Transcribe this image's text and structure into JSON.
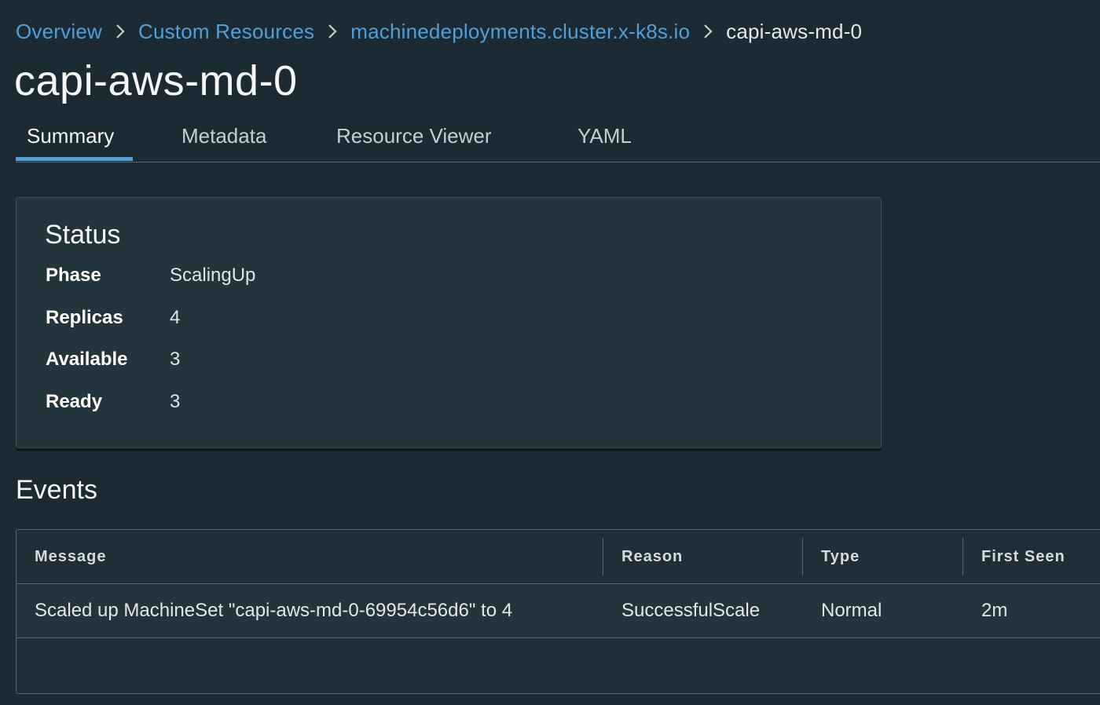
{
  "breadcrumb": {
    "items": [
      "Overview",
      "Custom Resources",
      "machinedeployments.cluster.x-k8s.io"
    ],
    "current": "capi-aws-md-0"
  },
  "title": "capi-aws-md-0",
  "tabs": [
    {
      "label": "Summary",
      "active": true
    },
    {
      "label": "Metadata",
      "active": false
    },
    {
      "label": "Resource Viewer",
      "active": false
    },
    {
      "label": "YAML",
      "active": false
    }
  ],
  "status": {
    "title": "Status",
    "rows": [
      {
        "key": "Phase",
        "value": "ScalingUp"
      },
      {
        "key": "Replicas",
        "value": "4"
      },
      {
        "key": "Available",
        "value": "3"
      },
      {
        "key": "Ready",
        "value": "3"
      }
    ]
  },
  "events": {
    "title": "Events",
    "columns": [
      "Message",
      "Reason",
      "Type",
      "First Seen"
    ],
    "rows": [
      {
        "message": "Scaled up MachineSet \"capi-aws-md-0-69954c56d6\" to 4",
        "reason": "SuccessfulScale",
        "type": "Normal",
        "first_seen": "2m"
      }
    ]
  },
  "colors": {
    "background": "#1b2a33",
    "card": "#24343d",
    "link": "#4f9fd8",
    "accent": "#4f9fd8"
  }
}
